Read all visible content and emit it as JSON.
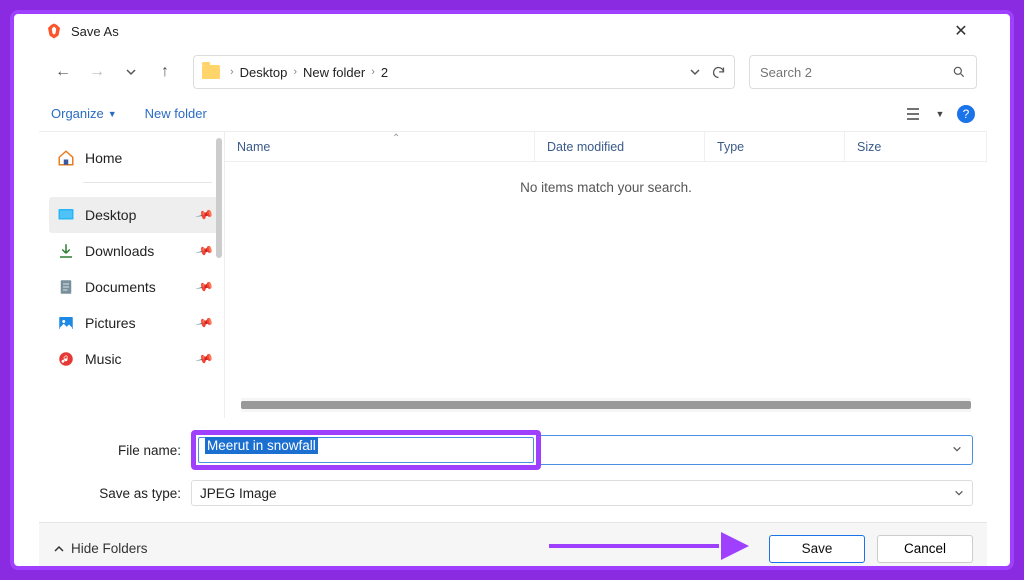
{
  "window": {
    "title": "Save As"
  },
  "breadcrumbs": [
    "Desktop",
    "New folder",
    "2"
  ],
  "search": {
    "placeholder": "Search 2"
  },
  "toolbar": {
    "organize": "Organize",
    "newfolder": "New folder"
  },
  "sidebar": {
    "items": [
      {
        "label": "Home"
      },
      {
        "label": "Desktop"
      },
      {
        "label": "Downloads"
      },
      {
        "label": "Documents"
      },
      {
        "label": "Pictures"
      },
      {
        "label": "Music"
      }
    ]
  },
  "columns": {
    "name": "Name",
    "date": "Date modified",
    "type": "Type",
    "size": "Size"
  },
  "empty_message": "No items match your search.",
  "form": {
    "filename_label": "File name:",
    "filename_value": "Meerut in snowfall",
    "savetype_label": "Save as type:",
    "savetype_value": "JPEG Image"
  },
  "footer": {
    "hide": "Hide Folders",
    "save": "Save",
    "cancel": "Cancel"
  }
}
